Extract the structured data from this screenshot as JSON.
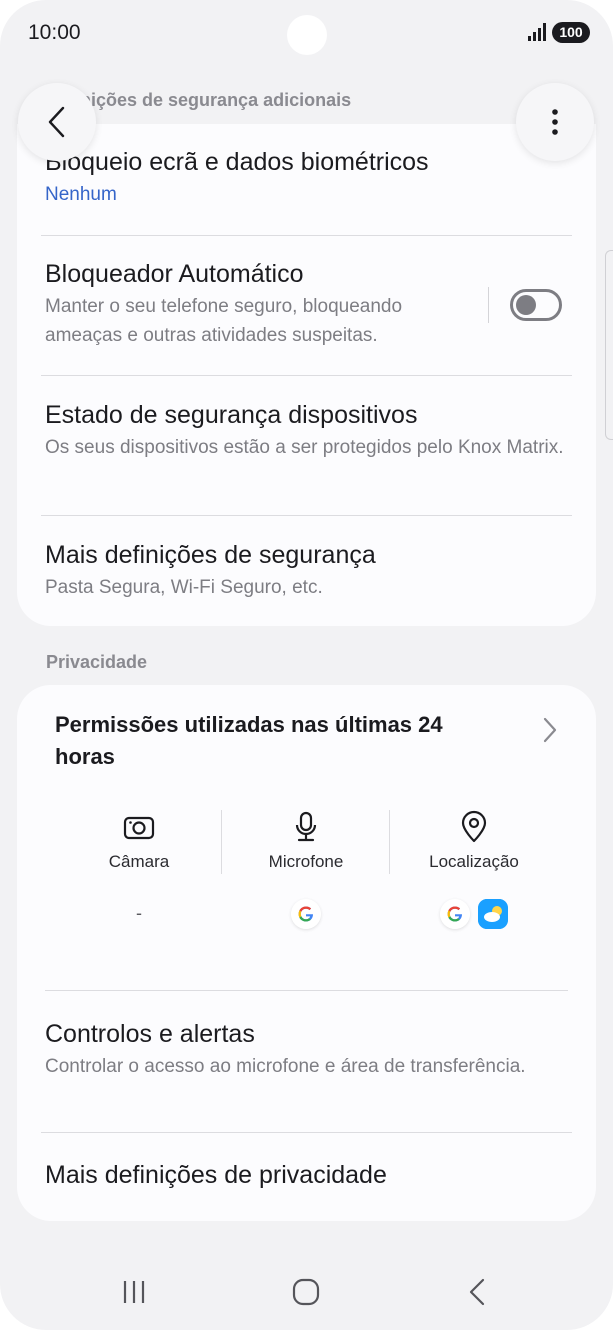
{
  "status_bar": {
    "time": "10:00",
    "battery": "100",
    "signal_icon": "signal-bars-icon"
  },
  "header": {
    "title": "Definições de segurança adicionais",
    "back_icon": "chevron-left-icon",
    "more_icon": "more-vertical-icon"
  },
  "security": {
    "items": [
      {
        "title": "Bloqueio ecrã e dados biométricos",
        "subtitle": "Nenhum"
      },
      {
        "title": "Bloqueador Automático",
        "subtitle": "Manter o seu telefone seguro, bloqueando ameaças e outras atividades suspeitas.",
        "toggle_on": false
      },
      {
        "title": "Estado de segurança dispositivos",
        "subtitle": "Os seus dispositivos estão a ser protegidos pelo Knox Matrix."
      },
      {
        "title": "Mais definições de segurança",
        "subtitle": "Pasta Segura, Wi-Fi Seguro, etc."
      }
    ]
  },
  "privacy": {
    "section_label": "Privacidade",
    "permissions_title": "Permissões utilizadas nas últimas 24 horas",
    "permissions": [
      {
        "label": "Câmara",
        "icon": "camera-icon",
        "apps": "-"
      },
      {
        "label": "Microfone",
        "icon": "microphone-icon",
        "apps": "google-app-icon"
      },
      {
        "label": "Localização",
        "icon": "location-pin-icon",
        "apps": "google-app-icon, weather-app-icon"
      }
    ],
    "items": [
      {
        "title": "Controlos e alertas",
        "subtitle": "Controlar o acesso ao microfone e área de transferência."
      },
      {
        "title": "Mais definições de privacidade"
      }
    ]
  },
  "navigation": {
    "recents_icon": "recents-icon",
    "home_icon": "home-icon",
    "back_icon": "back-nav-icon"
  },
  "colors": {
    "background": "#f2f2f4",
    "card": "#fcfcfe",
    "accent_blue": "#3565c9",
    "secondary_text": "#7d7d83"
  }
}
